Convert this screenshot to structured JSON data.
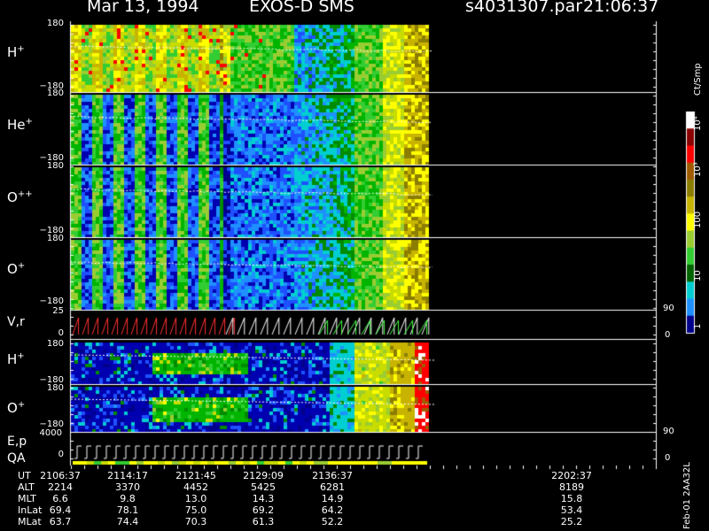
{
  "header": {
    "date": "Mar 13, 1994",
    "instrument": "EXOS-D SMS",
    "file": "s4031307.par",
    "time": "21:06:37"
  },
  "colorbar": {
    "unit_label": "Ct/Smp",
    "tick_labels": [
      "10⁴",
      "10³",
      "100",
      "10",
      "1"
    ],
    "colors": [
      "#ffffff",
      "#8b0000",
      "#ff0000",
      "#a05a00",
      "#8b7d00",
      "#c8b400",
      "#ffff00",
      "#9acd32",
      "#32cd32",
      "#006400",
      "#00ced1",
      "#1e90ff",
      "#00008b"
    ]
  },
  "panels": [
    {
      "species": "H",
      "charge": "+",
      "top": "180",
      "bottom": "−180"
    },
    {
      "species": "He",
      "charge": "+",
      "top": "180",
      "bottom": "−180"
    },
    {
      "species": "O",
      "charge": "++",
      "top": "180",
      "bottom": "−180"
    },
    {
      "species": "O",
      "charge": "+",
      "top": "180",
      "bottom": "−180"
    }
  ],
  "vr_panel": {
    "label": "V,r",
    "top": "25",
    "bottom": "0",
    "right_top": "90",
    "right_bottom": "0"
  },
  "lower_panels": [
    {
      "species": "H",
      "charge": "+",
      "top": "180",
      "bottom": "−180"
    },
    {
      "species": "O",
      "charge": "+",
      "top": "180",
      "bottom": "−180"
    }
  ],
  "ep_panel": {
    "label1": "E,p",
    "label2": "QA",
    "top": "4000",
    "bottom": "0",
    "right_top": "90",
    "right_bottom": "0"
  },
  "table": {
    "rows": [
      {
        "name": "UT",
        "values": [
          "2106:37",
          "2114:17",
          "2121:45",
          "2129:09",
          "2136:37",
          "2202:37"
        ]
      },
      {
        "name": "ALT",
        "values": [
          "2214",
          "3370",
          "4452",
          "5425",
          "6281",
          "8189"
        ]
      },
      {
        "name": "MLT",
        "values": [
          "6.6",
          "9.8",
          "13.0",
          "14.3",
          "14.9",
          "15.8"
        ]
      },
      {
        "name": "InLat",
        "values": [
          "69.4",
          "78.1",
          "75.0",
          "69.2",
          "64.2",
          "53.4"
        ]
      },
      {
        "name": "MLat",
        "values": [
          "63.7",
          "74.4",
          "70.3",
          "61.3",
          "52.2",
          "25.2"
        ]
      }
    ],
    "side_label": "Feb-01  2AA32L"
  },
  "chart_data": {
    "type": "heatmap",
    "title": "Mar 13, 1994   EXOS-D SMS",
    "x": [
      "2106:37",
      "2114:17",
      "2121:45",
      "2129:09",
      "2136:37",
      "2202:37"
    ],
    "ylim": [
      -180,
      180
    ],
    "series": [
      {
        "name": "H+",
        "values": []
      },
      {
        "name": "He+",
        "values": []
      },
      {
        "name": "O++",
        "values": []
      },
      {
        "name": "O+",
        "values": []
      }
    ]
  }
}
